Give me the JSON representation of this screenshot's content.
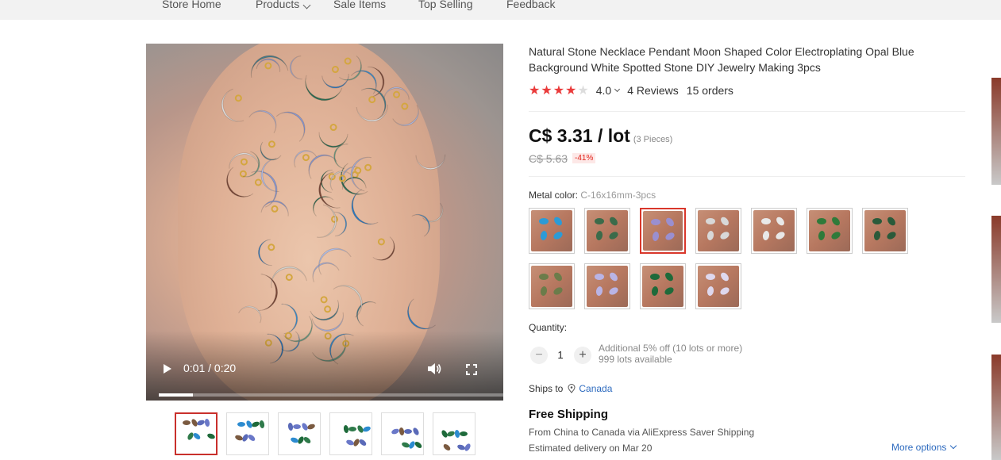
{
  "nav": {
    "items": [
      "Store Home",
      "Products",
      "Sale Items",
      "Top Selling",
      "Feedback"
    ]
  },
  "video": {
    "time": "0:01 / 0:20",
    "progress_fraction": 0.1
  },
  "thumbnails_count": 6,
  "product": {
    "title": "Natural Stone Necklace Pendant Moon Shaped Color Electroplating Opal Blue Background White Spotted Stone DIY Jewelry Making 3pcs",
    "rating": "4.0",
    "stars_filled": 4,
    "reviews": "4 Reviews",
    "orders": "15 orders",
    "price": "C$ 3.31 / lot",
    "pieces": "(3 Pieces)",
    "old_price": "C$ 5.63",
    "discount": "-41%"
  },
  "variants": {
    "label": "Metal color:",
    "selected": "C-16x16mm-3pcs",
    "selected_index": 2,
    "count": 11,
    "accent_colors": [
      "#2c9bd6",
      "#3b6b4a",
      "#9a8fd0",
      "#d8d8d8",
      "#e8e8e8",
      "#2f7a3a",
      "#2a5a3a",
      "#6b7c4a",
      "#b9b4e6",
      "#1e6a3a",
      "#ded8ee"
    ]
  },
  "quantity": {
    "label": "Quantity:",
    "minus": "−",
    "plus": "+",
    "value": "1",
    "note_line1": "Additional 5% off (10 lots or more)",
    "note_line2": "999 lots available"
  },
  "shipping": {
    "ships_to_label": "Ships to",
    "country": "Canada",
    "free_shipping": "Free Shipping",
    "route": "From China to Canada via AliExpress Saver Shipping",
    "estimated": "Estimated delivery on Mar 20",
    "more_options": "More options"
  },
  "colors": {
    "star": "#ea3b3b",
    "link": "#2e6bbf",
    "discount": "#e2231a",
    "selected_border": "#d9372b"
  }
}
